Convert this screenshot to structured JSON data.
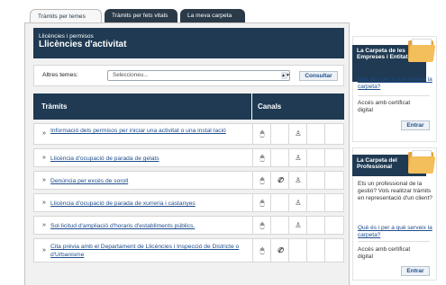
{
  "tabs": [
    {
      "label": "Tràmits per temes",
      "active": true
    },
    {
      "label": "Tràmits per fets vitals",
      "active": false
    },
    {
      "label": "La meva carpeta",
      "active": false
    }
  ],
  "header": {
    "subtitle": "Llicències i permisos",
    "title": "Llicències d'activitat"
  },
  "topics": {
    "label": "Altres temes:",
    "select_value": "Seleccioneu...",
    "submit_label": "Consultar"
  },
  "table": {
    "col_procedures": "Tràmits",
    "col_channels": "Canals"
  },
  "procedures": [
    {
      "label": "Informació dels permisos per iniciar una activitat o una instal·lació",
      "channels": [
        "mouse-icon",
        "",
        "person-icon",
        "",
        ""
      ]
    },
    {
      "label": "Llicència d'ocupació de parada de gelats",
      "channels": [
        "mouse-icon",
        "",
        "person-icon",
        "",
        ""
      ]
    },
    {
      "label": "Denúncia per excés de soroll",
      "channels": [
        "mouse-icon",
        "phone-icon",
        "person-icon",
        "",
        ""
      ]
    },
    {
      "label": "Llicència d'ocupació de parada de xurreria i castanyes",
      "channels": [
        "mouse-icon",
        "",
        "person-icon",
        "",
        ""
      ]
    },
    {
      "label": "Sol·licitud d'ampliació d'horaris d'establiments públics.",
      "channels": [
        "mouse-icon",
        "",
        "person-icon",
        "",
        ""
      ]
    },
    {
      "label": "Cita prèvia amb el Departament de Llicències i Inspecció de Districte o d'Urbanisme",
      "channels": [
        "mouse-icon",
        "phone-icon",
        "",
        "",
        ""
      ]
    }
  ],
  "sidebar": {
    "companies": {
      "title": "La Carpeta de les Empreses i Entitats",
      "link": "Què és i per a què serveix la carpeta?",
      "text": "Accés amb certificat digital",
      "button": "Entrar"
    },
    "professional": {
      "title": "La Carpeta del Professional",
      "question": "Ets un professional de la gestió? Vols realitzar tràmits en representació d'un client?",
      "link": "Què és i per a què serveix la carpeta?",
      "text": "Accés amb certificat digital",
      "button": "Entrar"
    }
  },
  "icons": {
    "mouse-icon": "🖱",
    "phone-icon": "✆",
    "person-icon": "♙"
  }
}
